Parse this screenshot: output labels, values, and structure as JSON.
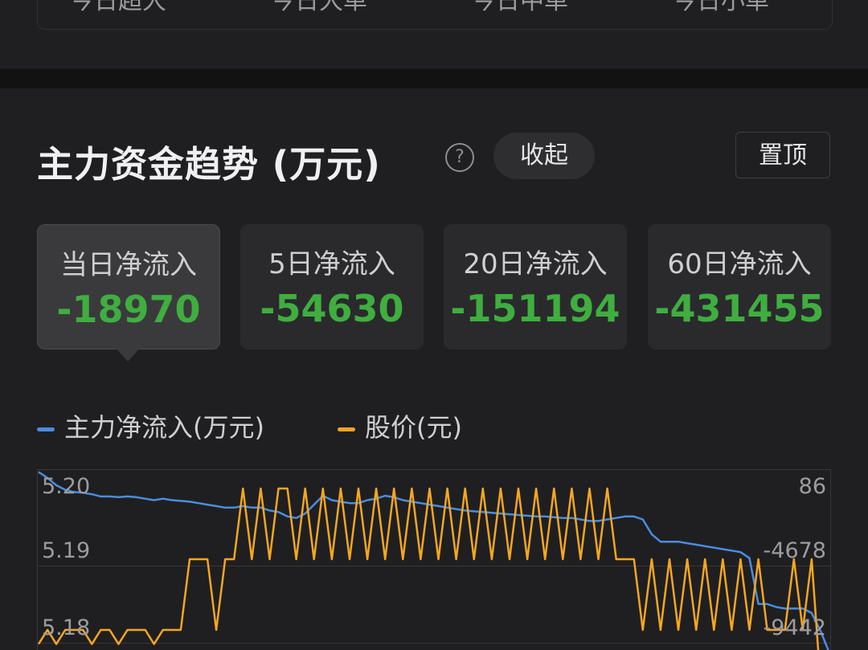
{
  "top_tabs": [
    "今日超大",
    "今日大单",
    "今日中单",
    "今日小单"
  ],
  "section": {
    "title": "主力资金趋势 (万元)",
    "help_icon": "question-circle-icon",
    "collapse_label": "收起",
    "pin_label": "置顶"
  },
  "stats": [
    {
      "label": "当日净流入",
      "value": "-18970",
      "active": true
    },
    {
      "label": "5日净流入",
      "value": "-54630",
      "active": false
    },
    {
      "label": "20日净流入",
      "value": "-151194",
      "active": false
    },
    {
      "label": "60日净流入",
      "value": "-431455",
      "active": false
    }
  ],
  "legend": [
    {
      "label": "主力净流入(万元)",
      "color": "#4a8de0"
    },
    {
      "label": "股价(元)",
      "color": "#f5a623"
    }
  ],
  "chart_data": {
    "type": "line",
    "left_axis_ticks": [
      "5.20",
      "5.19",
      "5.18"
    ],
    "right_axis_ticks": [
      "86",
      "-4678",
      "-9442"
    ],
    "grid": true,
    "series": [
      {
        "name": "主力净流入(万元)",
        "axis": "right",
        "color": "#4a8de0",
        "values": [
          1200,
          800,
          300,
          0,
          -150,
          -200,
          -300,
          -450,
          -450,
          -500,
          -450,
          -500,
          -600,
          -700,
          -600,
          -700,
          -750,
          -800,
          -900,
          -1000,
          -1100,
          -1200,
          -1200,
          -1100,
          -1200,
          -1200,
          -1400,
          -1500,
          -1800,
          -1900,
          -1600,
          -1000,
          -400,
          -700,
          -800,
          -900,
          -900,
          -700,
          -600,
          -400,
          -500,
          -700,
          -800,
          -900,
          -1000,
          -1100,
          -1200,
          -1300,
          -1400,
          -1450,
          -1500,
          -1550,
          -1600,
          -1650,
          -1700,
          -1750,
          -1800,
          -1800,
          -1850,
          -1900,
          -1900,
          -2000,
          -2100,
          -2100,
          -2000,
          -1900,
          -1800,
          -1800,
          -2000,
          -3000,
          -3500,
          -3500,
          -3500,
          -3600,
          -3700,
          -3800,
          -3900,
          -4000,
          -4100,
          -4200,
          -4600,
          -7700,
          -7700,
          -7900,
          -8000,
          -8000,
          -8000,
          -8300,
          -9500,
          -11000
        ]
      },
      {
        "name": "股价(元)",
        "axis": "left",
        "color": "#f5a623",
        "values": [
          5.178,
          5.18,
          5.178,
          5.18,
          5.18,
          5.18,
          5.178,
          5.18,
          5.18,
          5.178,
          5.18,
          5.18,
          5.18,
          5.178,
          5.18,
          5.18,
          5.18,
          5.19,
          5.19,
          5.19,
          5.18,
          5.19,
          5.19,
          5.2,
          5.19,
          5.2,
          5.19,
          5.2,
          5.2,
          5.19,
          5.2,
          5.19,
          5.2,
          5.19,
          5.2,
          5.19,
          5.2,
          5.19,
          5.2,
          5.19,
          5.2,
          5.19,
          5.2,
          5.19,
          5.2,
          5.19,
          5.2,
          5.19,
          5.2,
          5.19,
          5.2,
          5.19,
          5.2,
          5.19,
          5.2,
          5.19,
          5.2,
          5.19,
          5.2,
          5.19,
          5.2,
          5.19,
          5.2,
          5.19,
          5.2,
          5.19,
          5.19,
          5.19,
          5.18,
          5.19,
          5.18,
          5.19,
          5.18,
          5.19,
          5.18,
          5.19,
          5.18,
          5.19,
          5.18,
          5.19,
          5.18,
          5.19,
          5.18,
          5.18,
          5.18,
          5.19,
          5.18,
          5.19,
          5.17,
          5.168
        ]
      }
    ]
  }
}
